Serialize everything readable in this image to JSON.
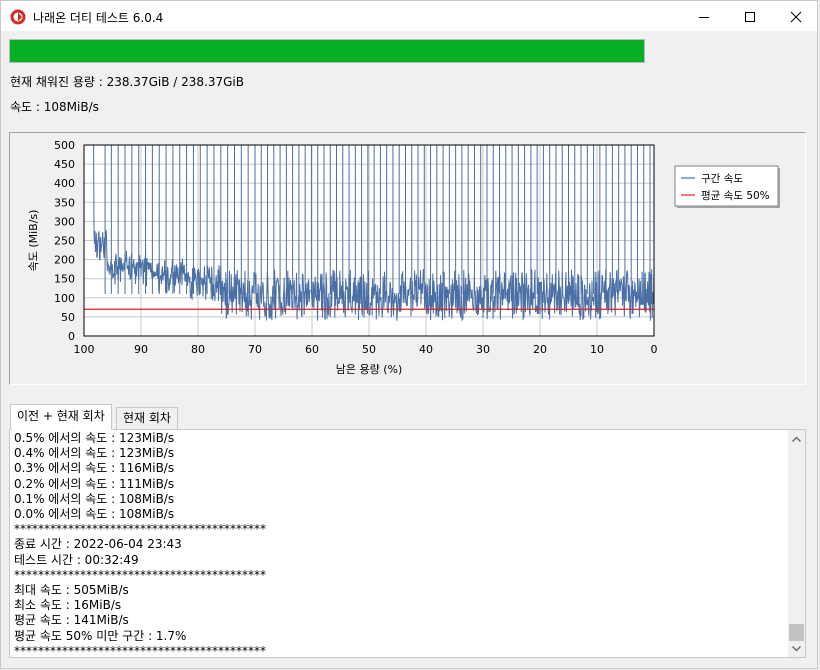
{
  "window": {
    "title": "나래온 더티 테스트 6.0.4",
    "controls": [
      "minimize",
      "maximize",
      "close"
    ]
  },
  "progress": {
    "fraction": 1.0,
    "color": "#06b025"
  },
  "status": {
    "capacity": "현재 채워진 용량 : 238.37GiB / 238.37GiB",
    "speed": "속도 : 108MiB/s"
  },
  "chart_data": {
    "type": "line",
    "ylabel": "속도 (MiB/s)",
    "xlabel": "남은 용량 (%)",
    "x_ticks": [
      "100",
      "90",
      "80",
      "70",
      "60",
      "50",
      "40",
      "30",
      "20",
      "10",
      "0"
    ],
    "y_ticks": [
      "0",
      "50",
      "100",
      "150",
      "200",
      "250",
      "300",
      "350",
      "400",
      "450",
      "500"
    ],
    "xlim": [
      100,
      0
    ],
    "ylim": [
      0,
      500
    ],
    "grid": true,
    "legend_position": "top-right (outside plot)",
    "series": [
      {
        "name": "구간 속도",
        "color": "#4a6fa5",
        "segments": [
          {
            "x_from": 100,
            "x_to": 98.3,
            "value": 505,
            "noise": 5
          },
          {
            "x_from": 98.3,
            "x_to": 96,
            "value": 240,
            "noise": 40
          },
          {
            "x_from": 96,
            "x_to": 88,
            "value": 175,
            "noise": 25
          },
          {
            "x_from": 88,
            "x_to": 82,
            "value": 155,
            "noise": 25
          },
          {
            "x_from": 82,
            "x_to": 76,
            "value": 140,
            "noise": 30
          },
          {
            "x_from": 76,
            "x_to": 0,
            "value": 105,
            "noise": 45
          }
        ],
        "spikes_to_max_at": [
          96.3,
          95.2,
          94,
          92.8,
          91.6,
          90.4,
          89.2,
          88,
          86.8,
          85.6,
          84.4,
          83.2,
          82,
          80.8,
          79.6,
          78.4,
          77.2,
          76,
          74.8,
          73.6,
          72.4,
          71.2,
          70,
          68.9,
          67.8,
          66.7,
          65.6,
          64.5,
          63.4,
          62.3,
          61.2,
          60.1,
          59,
          57.9,
          56.8,
          55.7,
          54.6,
          53.5,
          52.4,
          51.3,
          50.2,
          49.1,
          48,
          46.9,
          45.8,
          44.7,
          43.6,
          42.5,
          41.4,
          40.3,
          39.2,
          38.1,
          37,
          35.9,
          34.8,
          33.7,
          32.6,
          31.5,
          30.4,
          29.3,
          28.2,
          27.1,
          26,
          24.9,
          23.8,
          22.7,
          21.6,
          20.5,
          19.4,
          18.3,
          17.2,
          16.1,
          15,
          13.9,
          12.8,
          11.7,
          10.6,
          9.5,
          8.4,
          7.3,
          6.2,
          5.1,
          4,
          2.9,
          1.8,
          0.7
        ],
        "spike_value": 500
      },
      {
        "name": "평균 속도 50%",
        "color": "#e02020",
        "values": [
          70
        ]
      }
    ]
  },
  "tabs": [
    {
      "label": "이전 + 현재 회차",
      "active": true
    },
    {
      "label": "현재 회차",
      "active": false
    }
  ],
  "log": {
    "lines": [
      "0.5% 에서의 속도 : 123MiB/s",
      "0.4% 에서의 속도 : 123MiB/s",
      "0.3% 에서의 속도 : 116MiB/s",
      "0.2% 에서의 속도 : 111MiB/s",
      "0.1% 에서의 속도 : 108MiB/s",
      "0.0% 에서의 속도 : 108MiB/s",
      "******************************************",
      "종료 시간 : 2022-06-04 23:43",
      "테스트 시간 : 00:32:49",
      "******************************************",
      "최대 속도 : 505MiB/s",
      "최소 속도 : 16MiB/s",
      "평균 속도 : 141MiB/s",
      "평균 속도 50% 미만 구간 : 1.7%",
      "******************************************"
    ]
  }
}
